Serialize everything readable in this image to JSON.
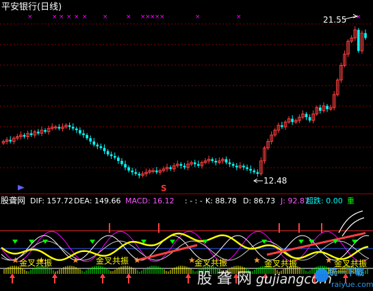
{
  "title": "平安银行(日线)",
  "price_panel": {
    "high_annotation": "21.55",
    "low_annotation": "12.48",
    "high_value": 21.55,
    "low_value": 12.48,
    "s_marker": "S"
  },
  "indicator_bar": {
    "name": "股聋网",
    "dif_label": "DIF: 157.72",
    "dea_label": "DEA: 149.66",
    "macd_label": "MACD: 16.12",
    "sep_label": ": - : -",
    "k_label": "K: 88.78",
    "d_label": "D: 86.73",
    "j_label": "J: 92.87",
    "overdrop_label": "超跌: 0.00",
    "heavy_label": "重"
  },
  "signal_labels": [
    "金叉共振",
    "金叉共振",
    "金叉共振",
    "金叉共振",
    "金叉共振"
  ],
  "watermarks": {
    "site_cn": "股 聋 网",
    "site_en": "gujiangcom",
    "logo_cn": "统一下载",
    "logo_en": "raiyue.com"
  },
  "colors": {
    "background": "#000000",
    "up": "#ff4040",
    "down": "#00ffff",
    "grid": "#8b0000",
    "gold": "#ffff00",
    "magenta": "#ff00ff",
    "green": "#00ff00"
  },
  "chart_data": {
    "type": "candlestick",
    "ylim": [
      12.0,
      22.5
    ],
    "closes": [
      14.6,
      14.7,
      14.6,
      14.8,
      14.9,
      15.0,
      14.9,
      15.1,
      15.0,
      15.2,
      15.1,
      15.3,
      15.2,
      15.4,
      15.5,
      15.5,
      15.4,
      15.5,
      15.6,
      15.5,
      15.4,
      15.3,
      15.1,
      15.0,
      14.8,
      14.6,
      14.4,
      14.3,
      14.2,
      14.0,
      13.8,
      13.7,
      13.6,
      13.4,
      13.2,
      13.0,
      12.8,
      12.7,
      12.6,
      12.5,
      12.6,
      12.7,
      12.8,
      12.8,
      12.7,
      12.8,
      12.9,
      13.0,
      12.9,
      13.1,
      13.2,
      13.1,
      13.0,
      13.2,
      13.3,
      13.2,
      13.1,
      13.3,
      13.4,
      13.5,
      13.4,
      13.3,
      13.4,
      13.5,
      13.3,
      13.2,
      13.1,
      13.0,
      13.1,
      13.0,
      12.9,
      12.8,
      12.7,
      12.6,
      13.4,
      14.2,
      14.6,
      15.0,
      15.3,
      15.6,
      15.5,
      15.8,
      16.0,
      15.8,
      15.9,
      16.1,
      16.3,
      16.1,
      15.9,
      16.3,
      16.7,
      16.5,
      16.8,
      16.6,
      16.7,
      17.5,
      18.4,
      19.3,
      20.0,
      20.8,
      21.0,
      21.5,
      20.2,
      21.3,
      21.0
    ]
  }
}
